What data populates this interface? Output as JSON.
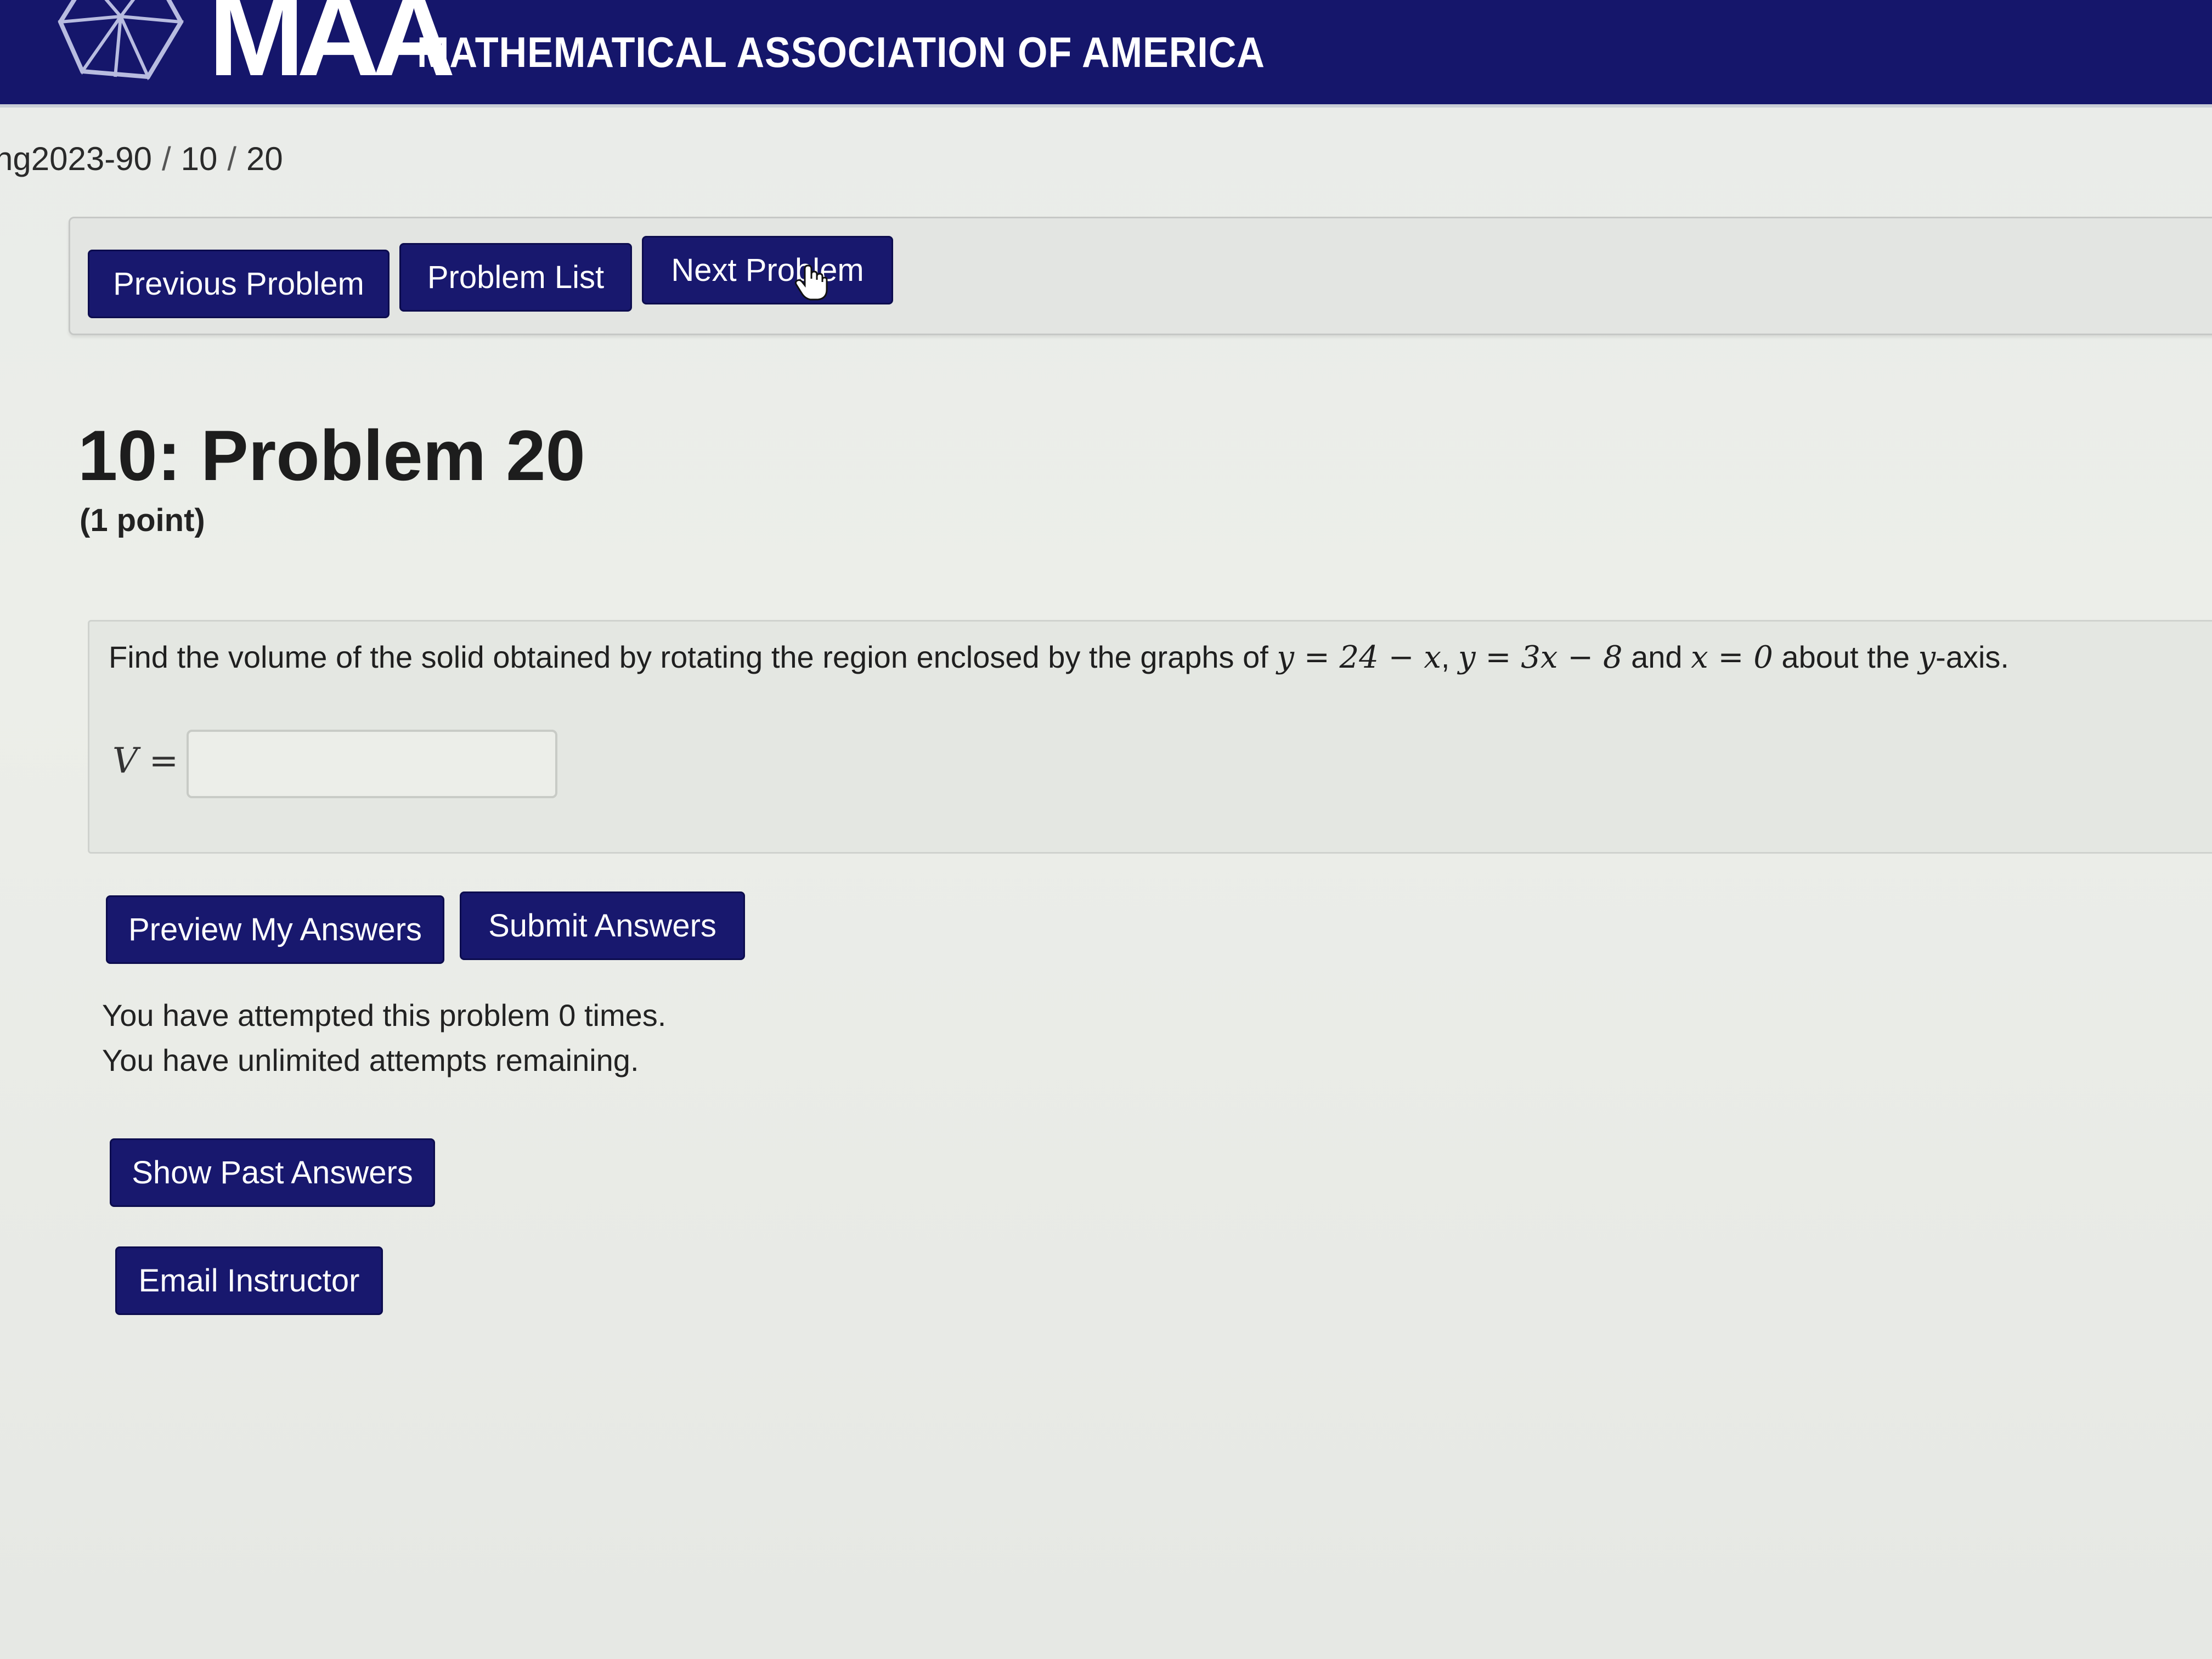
{
  "header": {
    "logo_short": "MAA",
    "logo_full": "MATHEMATICAL ASSOCIATION OF AMERICA",
    "logo_icon": "polyhedron-logo-icon",
    "background_color": "#15166b"
  },
  "breadcrumb": {
    "course": "ng2023-90",
    "set": "10",
    "problem": "20",
    "separator": "/"
  },
  "nav": {
    "previous_label": "Previous Problem",
    "list_label": "Problem List",
    "next_label": "Next Problem"
  },
  "problem": {
    "title": "10: Problem 20",
    "points": "(1 point)",
    "statement": {
      "intro": "Find the volume of the solid obtained by rotating the region enclosed by the graphs of ",
      "eq1": "y = 24 − x",
      "comma": ", ",
      "eq2": "y = 3x − 8",
      "and": " and ",
      "eq3": "x = 0",
      "about": " about the ",
      "axis_var": "y",
      "axis_suffix": "-axis."
    },
    "answer_label": "V =",
    "answer_value": ""
  },
  "actions": {
    "preview_label": "Preview My Answers",
    "submit_label": "Submit Answers",
    "past_label": "Show Past Answers",
    "email_label": "Email Instructor"
  },
  "status": {
    "attempts_line": "You have attempted this problem 0 times.",
    "remaining_line": "You have unlimited attempts remaining."
  },
  "colors": {
    "button": "#18186e",
    "button_text": "#ffffff"
  }
}
